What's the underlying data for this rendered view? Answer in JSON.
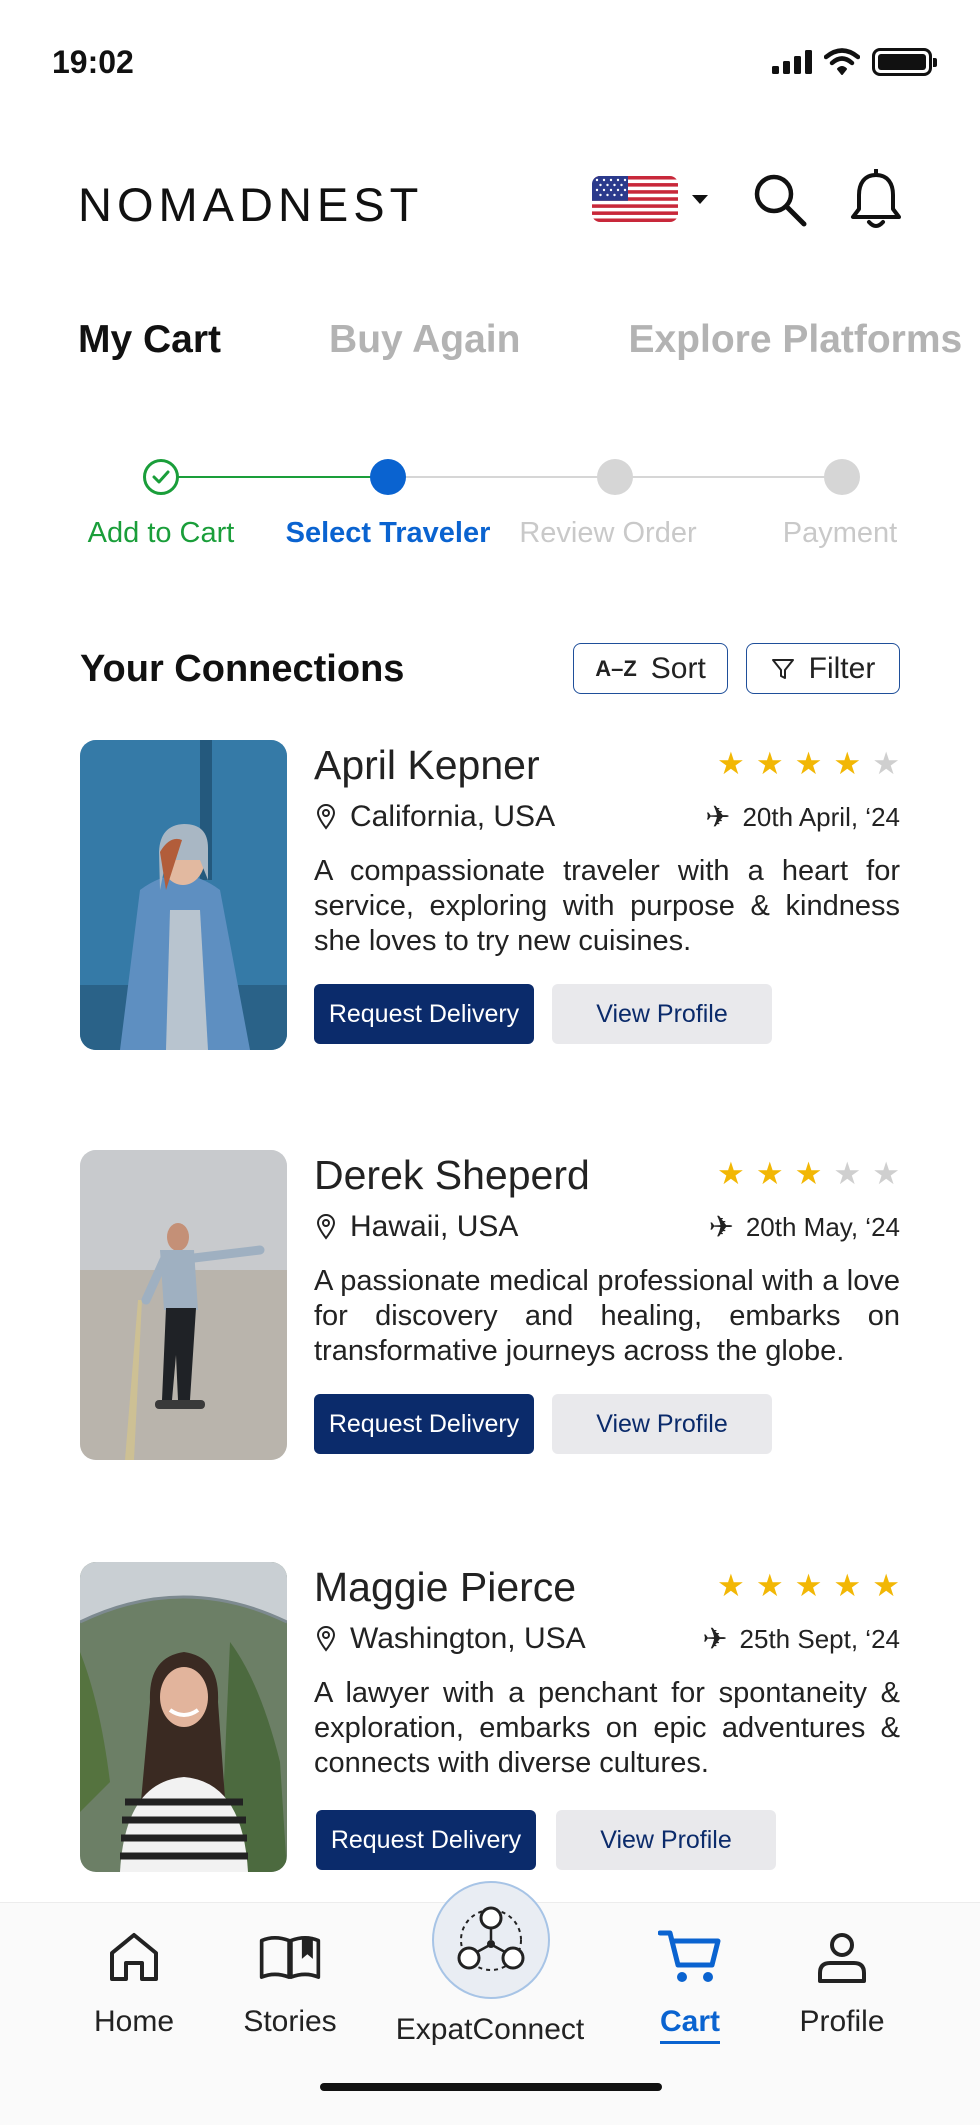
{
  "status_bar": {
    "time": "19:02"
  },
  "header": {
    "logo": "NOMADNEST"
  },
  "tabs": [
    {
      "label": "My Cart",
      "active": true
    },
    {
      "label": "Buy Again",
      "active": false
    },
    {
      "label": "Explore Platforms",
      "active": false
    }
  ],
  "stepper": {
    "steps": [
      {
        "label": "Add to Cart",
        "state": "done"
      },
      {
        "label": "Select Traveler",
        "state": "current"
      },
      {
        "label": "Review Order",
        "state": "todo"
      },
      {
        "label": "Payment",
        "state": "todo"
      }
    ]
  },
  "section": {
    "title": "Your Connections",
    "sort_label": "Sort",
    "sort_icon": "A–Z",
    "filter_label": "Filter"
  },
  "travelers": [
    {
      "name": "April Kepner",
      "rating": 4,
      "location": "California, USA",
      "date": "20th April, ‘24",
      "description": "A compassionate traveler with a heart for service, exploring with purpose & kindness she loves to try new cuisines.",
      "request_label": "Request Delivery",
      "profile_label": "View Profile"
    },
    {
      "name": "Derek Sheperd",
      "rating": 3,
      "location": "Hawaii, USA",
      "date": "20th May, ‘24",
      "description": "A passionate medical professional with a love for discovery and healing, embarks on transformative journeys across the globe.",
      "request_label": "Request Delivery",
      "profile_label": "View Profile"
    },
    {
      "name": "Maggie Pierce",
      "rating": 5,
      "location": "Washington, USA",
      "date": "25th Sept, ‘24",
      "description": "A lawyer with a penchant for spontaneity & exploration, embarks on epic adventures & connects with diverse cultures.",
      "request_label": "Request Delivery",
      "profile_label": "View Profile"
    }
  ],
  "bottom_nav": {
    "items": [
      {
        "label": "Home",
        "icon": "home-icon"
      },
      {
        "label": "Stories",
        "icon": "book-icon"
      },
      {
        "label": "ExpatConnect",
        "icon": "network-icon"
      },
      {
        "label": "Cart",
        "icon": "cart-icon",
        "active": true
      },
      {
        "label": "Profile",
        "icon": "user-icon"
      }
    ]
  },
  "colors": {
    "accent": "#0a63d0",
    "success": "#1a9e3a",
    "primary_button": "#0b2b6b",
    "star": "#f2b705"
  }
}
